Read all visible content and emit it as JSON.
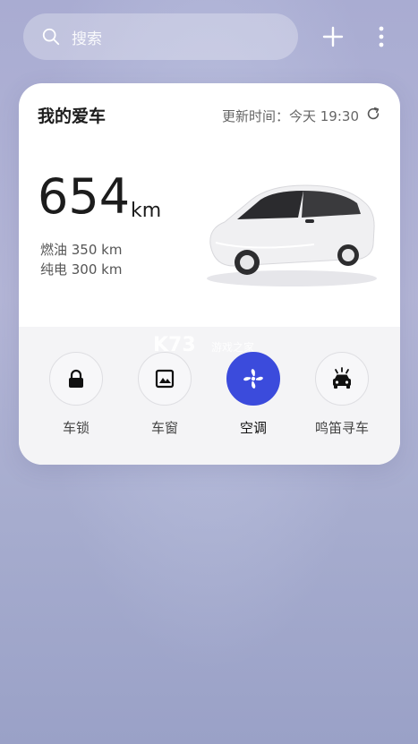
{
  "search": {
    "placeholder": "搜索",
    "icon": "search-icon"
  },
  "header_actions": {
    "add_icon": "plus-icon",
    "more_icon": "more-vertical-icon"
  },
  "card": {
    "title": "我的爱车",
    "update_label": "更新时间：今天 19:30",
    "refresh_icon": "refresh-icon",
    "range_value": "654",
    "range_unit": "km",
    "fuel_line": "燃油 350 km",
    "electric_line": "纯电 300 km",
    "controls": [
      {
        "label": "车锁",
        "icon": "lock-icon",
        "active": false
      },
      {
        "label": "车窗",
        "icon": "window-icon",
        "active": false
      },
      {
        "label": "空调",
        "icon": "fan-icon",
        "active": true
      },
      {
        "label": "鸣笛寻车",
        "icon": "car-horn-icon",
        "active": false
      }
    ]
  },
  "watermark": {
    "logo": "K73",
    "text": "游戏之家"
  },
  "colors": {
    "accent": "#3b4bdc",
    "card_bg": "#ffffff",
    "controls_bg": "#f4f4f6"
  }
}
